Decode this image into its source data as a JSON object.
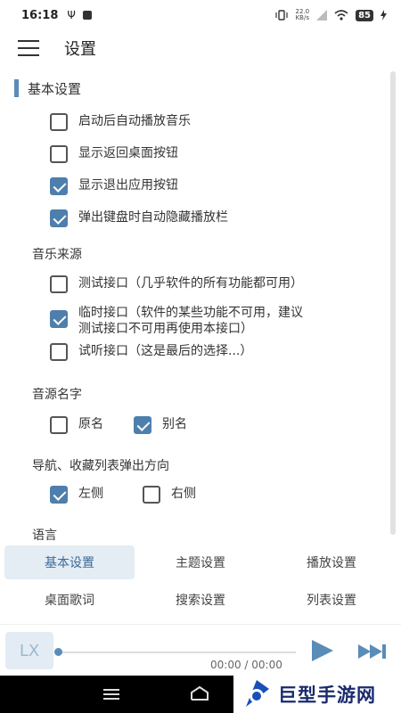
{
  "status_bar": {
    "time": "16:18",
    "net_speed_top": "22.0",
    "net_speed_bottom": "KB/s",
    "battery": "85"
  },
  "header": {
    "title": "设置"
  },
  "basic_settings": {
    "title": "基本设置",
    "options": [
      {
        "label": "启动后自动播放音乐",
        "checked": false
      },
      {
        "label": "显示返回桌面按钮",
        "checked": false
      },
      {
        "label": "显示退出应用按钮",
        "checked": true
      },
      {
        "label": "弹出键盘时自动隐藏播放栏",
        "checked": true
      }
    ]
  },
  "music_source": {
    "title": "音乐来源",
    "options": [
      {
        "label": "测试接口（几乎软件的所有功能都可用）",
        "checked": false
      },
      {
        "label_line1": "临时接口（软件的某些功能不可用，建议",
        "label_line2": "测试接口不可用再使用本接口）",
        "checked": true
      },
      {
        "label": "试听接口（这是最后的选择...）",
        "checked": false
      }
    ]
  },
  "source_name": {
    "title": "音源名字",
    "options": [
      {
        "label": "原名",
        "checked": false
      },
      {
        "label": "别名",
        "checked": true
      }
    ]
  },
  "nav_direction": {
    "title": "导航、收藏列表弹出方向",
    "options": [
      {
        "label": "左侧",
        "checked": true
      },
      {
        "label": "右侧",
        "checked": false
      }
    ]
  },
  "language": {
    "title": "语言"
  },
  "tabs": [
    {
      "label": "基本设置",
      "active": true
    },
    {
      "label": "主题设置",
      "active": false
    },
    {
      "label": "播放设置",
      "active": false
    },
    {
      "label": "桌面歌词",
      "active": false
    },
    {
      "label": "搜索设置",
      "active": false
    },
    {
      "label": "列表设置",
      "active": false
    }
  ],
  "player": {
    "cover_text": "LX",
    "time": "00:00 / 00:00",
    "progress": 0
  },
  "watermark": {
    "text": "巨型手游网"
  },
  "colors": {
    "accent": "#4e7fac",
    "tab_active_bg": "#e4ecf4"
  },
  "icons": [
    "menu-icon",
    "play-icon",
    "next-track-icon",
    "nav-menu-icon",
    "nav-home-icon",
    "wifi-icon",
    "signal-icon",
    "battery-icon"
  ]
}
